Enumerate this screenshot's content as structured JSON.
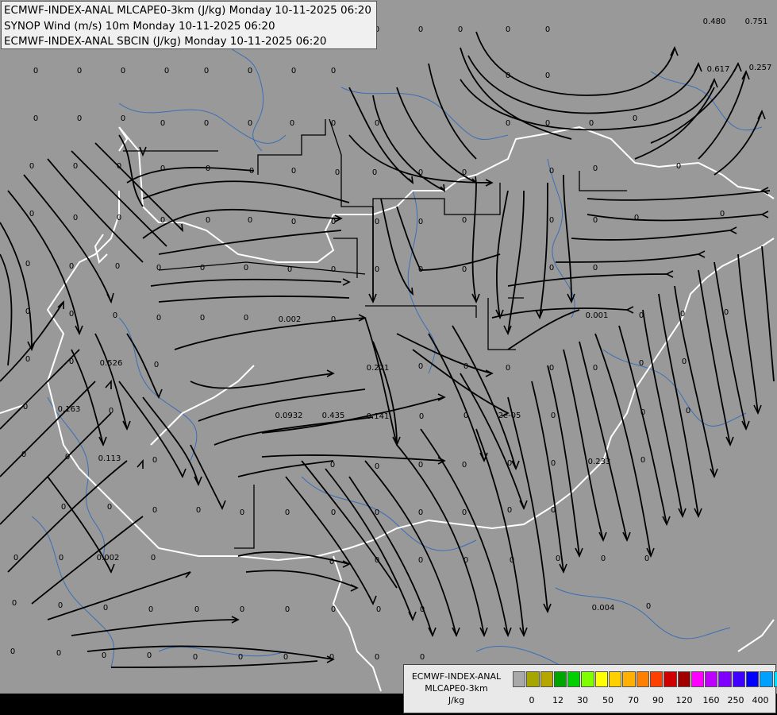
{
  "title_lines": [
    "ECMWF-INDEX-ANAL MLCAPE0-3km (J/kg) Monday 10-11-2025 06:20",
    "SYNOP Wind (m/s) 10m Monday 10-11-2025 06:20",
    "ECMWF-INDEX-ANAL SBCIN (J/kg) Monday 10-11-2025 06:20"
  ],
  "legend": {
    "title_lines": [
      "ECMWF-INDEX-ANAL",
      "MLCAPE0-3km",
      "J/kg"
    ],
    "colors": [
      "#a9a9a9",
      "#a6a600",
      "#b5a600",
      "#00a600",
      "#00d000",
      "#80ff00",
      "#ffff00",
      "#ffd000",
      "#ffb000",
      "#ff8000",
      "#ff4000",
      "#d00000",
      "#a00000",
      "#ff00ff",
      "#c000ff",
      "#8000ff",
      "#4000ff",
      "#0000ff",
      "#00a0ff",
      "#00e0ff",
      "#80ffff",
      "#ffffff"
    ],
    "tick_labels": [
      "0",
      "12",
      "30",
      "50",
      "70",
      "90",
      "120",
      "160",
      "250",
      "400"
    ]
  },
  "map": {
    "background": "#999999",
    "border_color": "#ffffff",
    "river_color": "#3070c0",
    "streamline_color": "#000000",
    "values": [
      "0",
      "0",
      "0",
      "0",
      "0",
      "0",
      "0",
      "0",
      "0",
      "0",
      "0",
      "0",
      "0.480",
      "0.751",
      "0",
      "0",
      "0",
      "0",
      "0",
      "0",
      "0",
      "0",
      "0",
      "0",
      "0.617",
      "0.257",
      "0",
      "0",
      "0",
      "0",
      "0",
      "0",
      "0",
      "0",
      "0",
      "0",
      "0",
      "0",
      "0",
      "0",
      "0",
      "0",
      "0",
      "0",
      "0",
      "0",
      "0",
      "0",
      "0",
      "0",
      "0",
      "0",
      "0",
      "0",
      "0",
      "0",
      "0",
      "0",
      "0",
      "0",
      "0",
      "0",
      "0",
      "0",
      "0",
      "0",
      "0",
      "0",
      "0",
      "0",
      "0",
      "0",
      "0",
      "0",
      "0",
      "0",
      "0",
      "0",
      "0",
      "0",
      "0",
      "0",
      "0",
      "0",
      "0",
      "0",
      "0",
      "0.002",
      "0",
      "0.001",
      "0",
      "0",
      "0",
      "0",
      "0",
      "0.526",
      "0",
      "0.221",
      "0",
      "0",
      "0",
      "0",
      "0",
      "0",
      "0",
      "0",
      "0.163",
      "0",
      "0.0932",
      "0.435",
      "0.141",
      "0",
      "0",
      "2e-05",
      "0",
      "0",
      "0",
      "0",
      "0",
      "0.113",
      "0",
      "0",
      "0",
      "0",
      "0",
      "0",
      "0",
      "0.233",
      "0",
      "0",
      "0",
      "0",
      "0",
      "0",
      "0",
      "0",
      "0",
      "0",
      "0",
      "0",
      "0",
      "0",
      "0",
      "0.002",
      "0",
      "0",
      "0",
      "0",
      "0",
      "0",
      "0",
      "0",
      "0",
      "0",
      "0",
      "0",
      "0",
      "0",
      "0",
      "0",
      "0",
      "0",
      "0",
      "0.004",
      "0",
      "0",
      "0",
      "0",
      "0",
      "0",
      "0",
      "0",
      "0",
      "0",
      "0"
    ]
  }
}
